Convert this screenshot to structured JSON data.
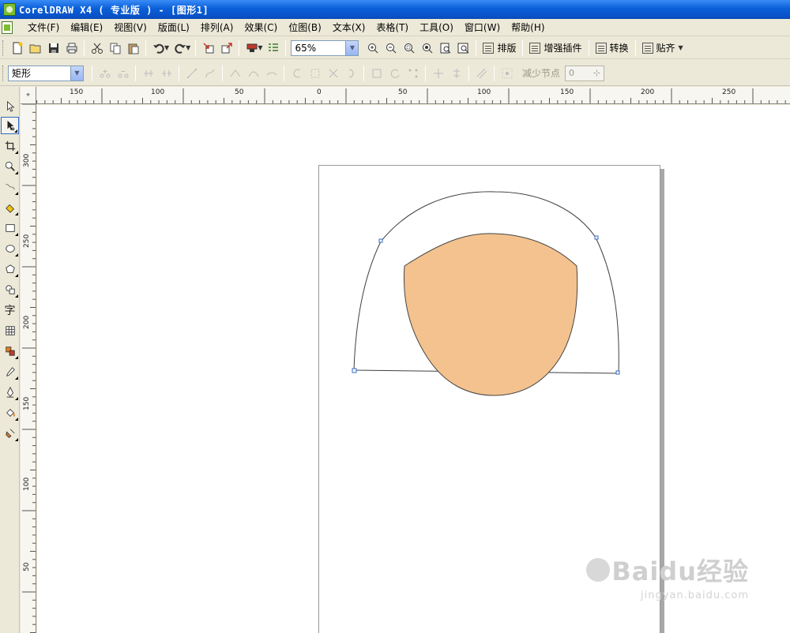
{
  "window": {
    "title": "CorelDRAW X4 ( 专业版 ) - [图形1]"
  },
  "menu": {
    "items": [
      "文件(F)",
      "编辑(E)",
      "视图(V)",
      "版面(L)",
      "排列(A)",
      "效果(C)",
      "位图(B)",
      "文本(X)",
      "表格(T)",
      "工具(O)",
      "窗口(W)",
      "帮助(H)"
    ]
  },
  "toolbar": {
    "zoom_value": "65%",
    "layout_label": "排版",
    "plugin_label": "增强插件",
    "convert_label": "转换",
    "snap_label": "贴齐"
  },
  "property_bar": {
    "object_type": "矩形",
    "reduce_nodes_label": "减少节点",
    "node_value": "0"
  },
  "ruler": {
    "horizontal": [
      "150",
      "100",
      "50",
      "0",
      "50",
      "100",
      "150",
      "200",
      "250"
    ],
    "vertical": [
      "300",
      "250",
      "200",
      "150",
      "100",
      "50"
    ]
  },
  "tools": {
    "text_tool_glyph": "字"
  },
  "colors": {
    "fill": "#f4c28e",
    "selection": "#316ac5"
  },
  "watermark": {
    "main": "Baidu经验",
    "sub": "jingyan.baidu.com"
  }
}
